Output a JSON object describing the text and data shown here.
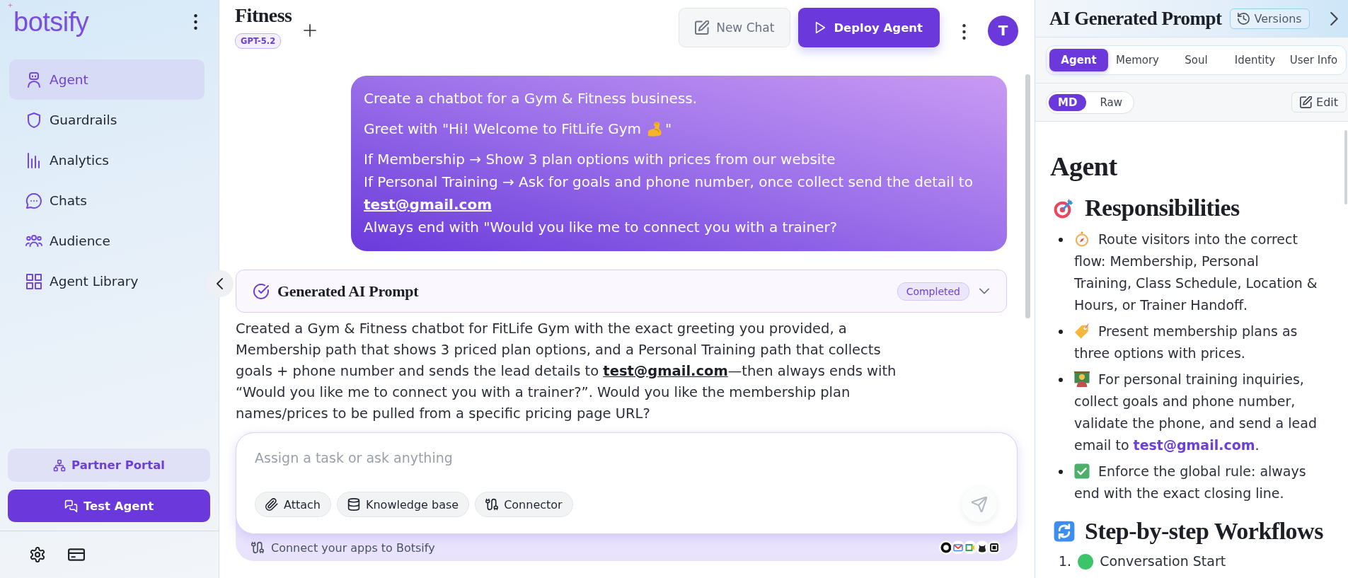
{
  "sidebar": {
    "logo": "botsify",
    "nav_items": [
      {
        "label": "Agent",
        "selected": true
      },
      {
        "label": "Guardrails",
        "selected": false
      },
      {
        "label": "Analytics",
        "selected": false
      },
      {
        "label": "Chats",
        "selected": false
      },
      {
        "label": "Audience",
        "selected": false
      },
      {
        "label": "Agent Library",
        "selected": false
      }
    ],
    "partner_button": "Partner Portal",
    "test_button": "Test Agent"
  },
  "header": {
    "title": "Fitness",
    "model_badge": "GPT-5.2",
    "new_chat_button": "New Chat",
    "deploy_button": "Deploy Agent",
    "avatar_initial": "T"
  },
  "user_message": {
    "paragraphs": [
      [
        {
          "kind": "text",
          "text": "Create a chatbot for a Gym & Fitness business."
        }
      ],
      [
        {
          "kind": "icon",
          "text": "Greet with \"Hi! Welcome to FitLife Gym",
          "after": "\""
        }
      ],
      [
        {
          "kind": "text",
          "text": "If Membership → Show 3 plan options with prices from our website"
        },
        {
          "kind": "link",
          "text": "If Personal Training → Ask for goals and phone number, once collect send the detail to",
          "link": "test@gmail.com"
        },
        {
          "kind": "text",
          "text": "Always end with \"Would you like me to connect you with a trainer?"
        }
      ]
    ]
  },
  "prompt_card": {
    "title": "Generated AI Prompt",
    "status": "Completed"
  },
  "response": {
    "before": "Created a Gym & Fitness chatbot for FitLife Gym with the exact greeting you provided, a Membership path that shows 3 priced plan options, and a Personal Training path that collects goals + phone number and sends the lead details to",
    "link": "test@gmail.com",
    "after": "—then always ends with “Would you like me to connect you with a trainer?”. Would you like the membership plan names/prices to be pulled from a specific pricing page URL?"
  },
  "composer": {
    "placeholder": "Assign a task or ask anything",
    "chips": [
      "Attach",
      "Knowledge base",
      "Connector"
    ],
    "apps_note": "Connect your apps to Botsify"
  },
  "prompt_panel": {
    "title": "AI Generated Prompt",
    "versions_button": "Versions",
    "tabs": [
      {
        "label": "Agent",
        "selected": true
      },
      {
        "label": "Memory",
        "selected": false
      },
      {
        "label": "Soul",
        "selected": false
      },
      {
        "label": "Identity",
        "selected": false
      },
      {
        "label": "User Info",
        "selected": false
      }
    ],
    "view_modes": [
      {
        "label": "MD",
        "selected": true
      },
      {
        "label": "Raw",
        "selected": false
      }
    ],
    "edit_button": "Edit",
    "heading": "Agent",
    "sections": [
      {
        "kind": "bullets",
        "title": "Responsibilities",
        "items": [
          {
            "text": "Route visitors into the correct flow: Membership, Personal Training, Class Schedule, Location & Hours, or Trainer Handoff."
          },
          {
            "text": "Present membership plans as three options with prices."
          },
          {
            "text": "For personal training inquiries, collect goals and phone number, validate the phone, and send a lead email to",
            "link": "test@gmail.com",
            "after": "."
          },
          {
            "text": "Enforce the global rule: always end with the exact closing line."
          }
        ]
      },
      {
        "kind": "numbered",
        "title": "Step-by-step Workflows",
        "items": [
          {
            "number": "1.",
            "text": "Conversation Start"
          }
        ]
      }
    ]
  }
}
